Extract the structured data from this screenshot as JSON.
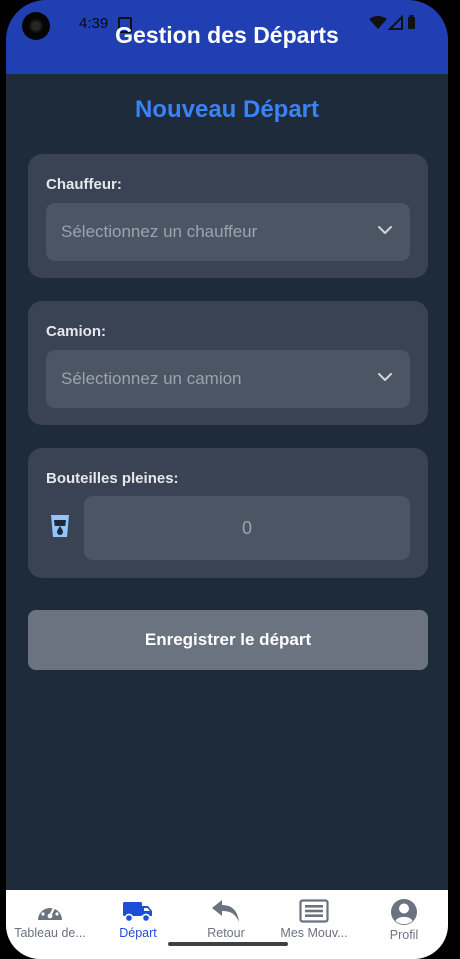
{
  "status_bar": {
    "time": "4:39"
  },
  "header": {
    "title": "Gestion des Départs"
  },
  "page": {
    "title": "Nouveau Départ"
  },
  "driver": {
    "label": "Chauffeur:",
    "placeholder": "Sélectionnez un chauffeur"
  },
  "truck": {
    "label": "Camion:",
    "placeholder": "Sélectionnez un camion"
  },
  "bottles": {
    "label": "Bouteilles pleines:",
    "value": "0"
  },
  "submit_label": "Enregistrer le départ",
  "nav": {
    "items": [
      {
        "label": "Tableau de...",
        "icon": "speedometer-icon",
        "active": false
      },
      {
        "label": "Départ",
        "icon": "truck-icon",
        "active": true
      },
      {
        "label": "Retour",
        "icon": "return-arrow-icon",
        "active": false
      },
      {
        "label": "Mes Mouv...",
        "icon": "list-icon",
        "active": false
      },
      {
        "label": "Profil",
        "icon": "profile-icon",
        "active": false
      }
    ]
  },
  "colors": {
    "header_bg": "#1f3fb3",
    "background": "#1d2b3a",
    "accent": "#3b82f6",
    "card": "#394353",
    "input": "#4b5563",
    "button": "#6b7280"
  }
}
